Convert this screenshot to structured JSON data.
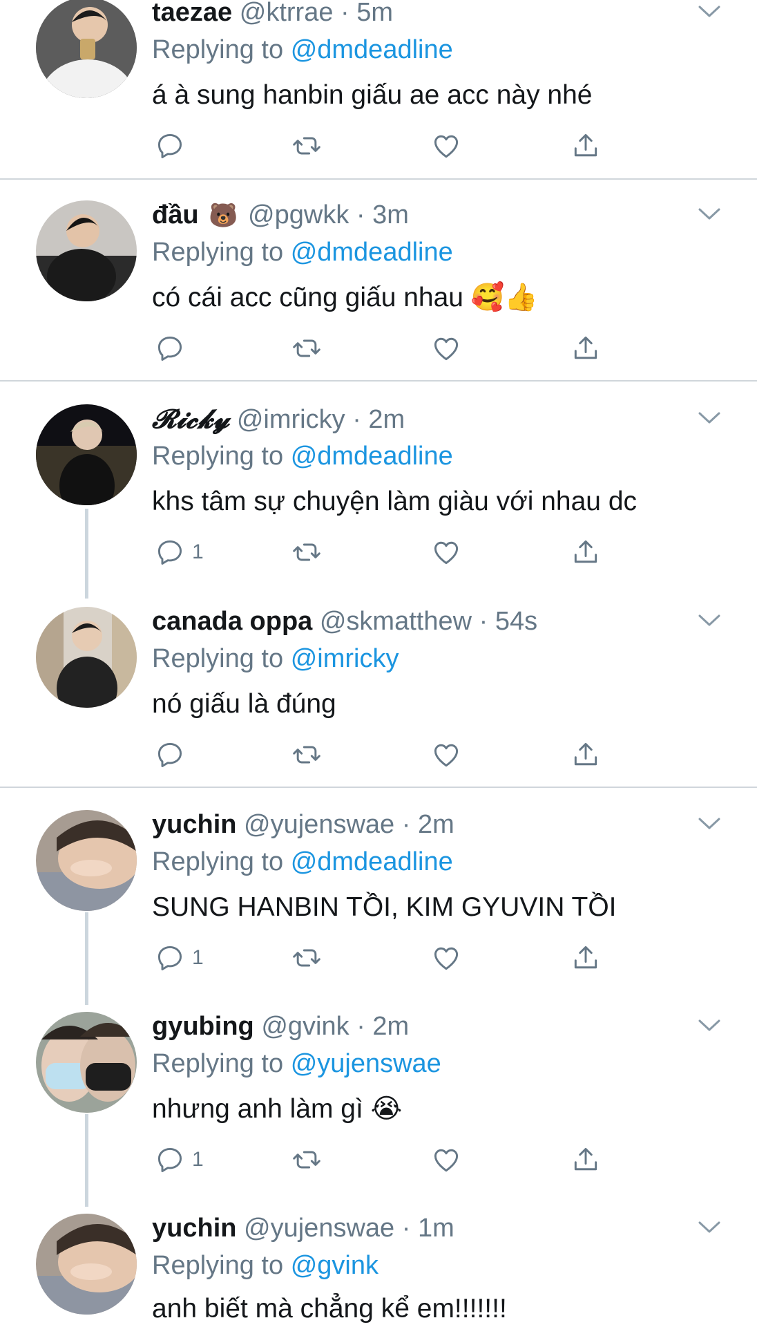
{
  "colors": {
    "link": "#1b95e0",
    "secondary": "#657786",
    "divider": "#d0d6db",
    "thread": "#ccd6dd"
  },
  "tweets": [
    {
      "name": "taezae",
      "name_emoji": "",
      "handle": "@ktrrae",
      "dot": "·",
      "time": "5m",
      "reply_prefix": "Replying to",
      "reply_to": "@dmdeadline",
      "text": "á à sung hanbin giấu ae acc này nhé",
      "reply_count": "",
      "avatar_icon": "avatar-photo"
    },
    {
      "name": "đầu",
      "name_emoji": "🐻",
      "handle": "@pgwkk",
      "dot": "·",
      "time": "3m",
      "reply_prefix": "Replying to",
      "reply_to": "@dmdeadline",
      "text": "có cái acc cũng giấu nhau 🥰👍",
      "reply_count": "",
      "avatar_icon": "avatar-photo"
    },
    {
      "name": "𝓡𝓲𝓬𝓴𝔂",
      "name_emoji": "",
      "handle": "@imricky",
      "dot": "·",
      "time": "2m",
      "reply_prefix": "Replying to",
      "reply_to": "@dmdeadline",
      "text": "khs tâm sự chuyện làm giàu với nhau dc",
      "reply_count": "1",
      "avatar_icon": "avatar-photo"
    },
    {
      "name": "canada oppa",
      "name_emoji": "",
      "handle": "@skmatthew",
      "dot": "·",
      "time": "54s",
      "reply_prefix": "Replying to",
      "reply_to": "@imricky",
      "text": "nó giấu là đúng",
      "reply_count": "",
      "avatar_icon": "avatar-photo"
    },
    {
      "name": "yuchin",
      "name_emoji": "",
      "handle": "@yujenswae",
      "dot": "·",
      "time": "2m",
      "reply_prefix": "Replying to",
      "reply_to": "@dmdeadline",
      "text": "SUNG HANBIN TỒI, KIM GYUVIN TỒI",
      "reply_count": "1",
      "avatar_icon": "avatar-photo"
    },
    {
      "name": "gyubing",
      "name_emoji": "",
      "handle": "@gvink",
      "dot": "·",
      "time": "2m",
      "reply_prefix": "Replying to",
      "reply_to": "@yujenswae",
      "text": "nhưng anh làm gì 😭",
      "reply_count": "1",
      "avatar_icon": "avatar-photo"
    },
    {
      "name": "yuchin",
      "name_emoji": "",
      "handle": "@yujenswae",
      "dot": "·",
      "time": "1m",
      "reply_prefix": "Replying to",
      "reply_to": "@gvink",
      "text": "anh biết mà chẳng kể em!!!!!!!",
      "reply_count": "",
      "avatar_icon": "avatar-photo"
    }
  ],
  "action_icons": [
    "reply-icon",
    "retweet-icon",
    "like-icon",
    "share-icon"
  ]
}
